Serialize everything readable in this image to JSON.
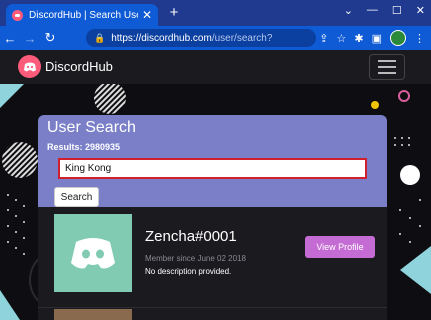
{
  "browser": {
    "tab_title": "DiscordHub | Search Users",
    "tab_close": "✕",
    "new_tab": "+",
    "window_controls": [
      "⌄",
      "—",
      "☐",
      "✕"
    ],
    "url_host": "https://discordhub.com",
    "url_path": "/user/search?",
    "icons": [
      "back-icon",
      "forward-icon",
      "reload-icon",
      "lock-icon",
      "share-icon",
      "star-icon",
      "extensions-icon",
      "sidebar-icon",
      "menu-icon"
    ]
  },
  "navbar": {
    "brand": "DiscordHub"
  },
  "search": {
    "title": "User Search",
    "results": "Results: 2980935",
    "query": "King Kong",
    "button_label": "Search"
  },
  "result": {
    "username": "Zencha#0001",
    "member_since": "Member since June 02 2018",
    "description": "No description provided.",
    "view_profile": "View Profile"
  },
  "colors": {
    "brand": "#ff5b7a",
    "card": "#7a7fc8",
    "view_button": "#c56bd4",
    "avatar_bg": "#82cbb3",
    "browser_blue": "#0f5bd6"
  }
}
